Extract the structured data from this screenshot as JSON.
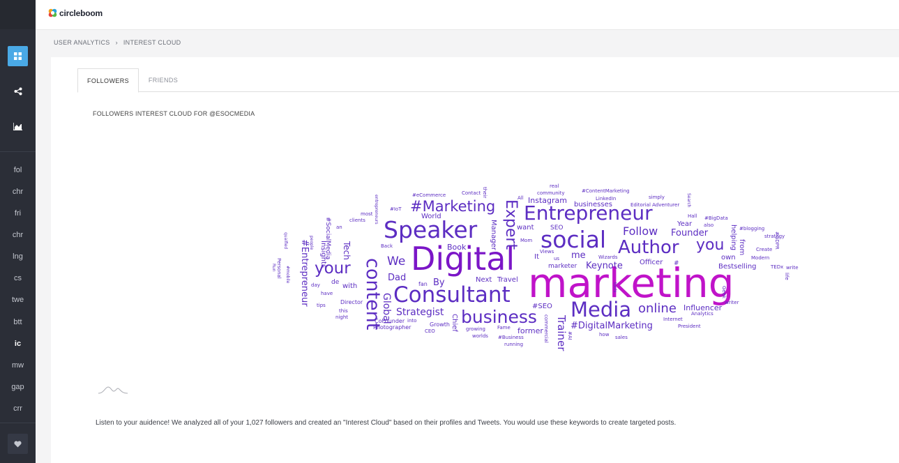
{
  "app": {
    "brand": "circleboom"
  },
  "colors": {
    "sidebar": "#2b2e37",
    "accent": "#4aa9e6",
    "cloud_primary": "#c013c9",
    "cloud_purple": "#7b16c7",
    "cloud_violet": "#5c2dc2"
  },
  "sidebar": {
    "icons": [
      "dashboard-icon",
      "share-icon",
      "chart-icon"
    ],
    "items": [
      {
        "label": "fol"
      },
      {
        "label": "chr"
      },
      {
        "label": "fri"
      },
      {
        "label": "chr"
      },
      {
        "label": "lng"
      },
      {
        "label": "cs"
      },
      {
        "label": "twe"
      },
      {
        "label": "btt"
      },
      {
        "label": "ic"
      },
      {
        "label": "mw"
      },
      {
        "label": "gap"
      },
      {
        "label": "crr"
      }
    ],
    "current": "ic",
    "bottom_icon": "heart-icon"
  },
  "breadcrumb": {
    "section": "USER ANALYTICS",
    "separator": "›",
    "page": "INTEREST CLOUD"
  },
  "tabs": [
    {
      "label": "FOLLOWERS",
      "active": true
    },
    {
      "label": "FRIENDS",
      "active": false
    }
  ],
  "cloud": {
    "title": "FOLLOWERS INTEREST CLOUD FOR @ESOCMEDIA",
    "words": [
      "marketing",
      "Digital",
      "Consultant",
      "Speaker",
      "Entrepreneur",
      "social",
      "Media",
      "business",
      "content",
      "Author",
      "#Marketing",
      "Expert",
      "your",
      "you",
      "online",
      "Follow",
      "Trainer",
      "Founder",
      "We",
      "Strategist",
      "#DigitalMarketing",
      "Keynote",
      "Influencer",
      "Global",
      "#Entrepreneur",
      "Dad",
      "By",
      "Bestselling",
      "me",
      "former",
      "Instagram",
      "Tech",
      "Book",
      "#SEO",
      "businesses",
      "Officer",
      "Year",
      "Insights",
      "Travel",
      "Next",
      "want",
      "World",
      "Manager",
      "Chief",
      "helping",
      "own",
      "with",
      "from",
      "It",
      "marketer",
      "SEO",
      "de",
      "fan",
      "#SocialMedia",
      "#",
      "Growth",
      "CoFounder",
      "Director",
      "Photographer",
      "have",
      "day",
      "tips",
      "night",
      "this",
      "Personal",
      "Run",
      "quaified",
      "people",
      "an",
      "clients",
      "most",
      "#IoT",
      "#eCommerce",
      "Contact",
      "their",
      "real",
      "community",
      "#ContentMarketing",
      "LinkedIn",
      "simply",
      "Editorial Adventurer",
      "Search",
      "Hall",
      "#BigData",
      "also",
      "#blogging",
      "strategy",
      "#GDPR",
      "Create",
      "Modern",
      "TEDx",
      "write",
      "Geek",
      "writer",
      "Internet",
      "Analytics",
      "President",
      "tools",
      "sales",
      "how",
      "#AI",
      "commercial",
      "running",
      "worlds",
      "#Business",
      "Fame",
      "CEO",
      "growing",
      "into",
      "Views",
      "Mom",
      "All",
      "us",
      "Wizards",
      "Back",
      "entrepreneurs",
      "#mobile",
      "life"
    ]
  },
  "description": "Listen to your auidence! We analyzed all of your 1,027 followers and created an \"Interest Cloud\" based on their profiles and Tweets. You would use these keywords to create targeted posts."
}
